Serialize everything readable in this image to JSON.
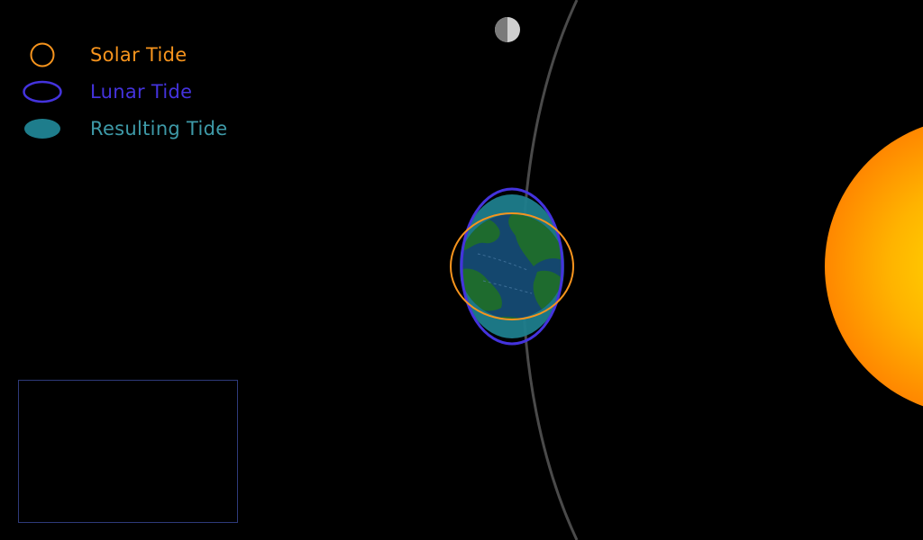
{
  "legend": {
    "items": [
      {
        "key": "solar",
        "label": "Solar Tide",
        "color": "#F7941D"
      },
      {
        "key": "lunar",
        "label": "Lunar Tide",
        "color": "#4433DD"
      },
      {
        "key": "result",
        "label": "Resulting Tide",
        "color": "#1E7D8C"
      }
    ]
  },
  "colors": {
    "background": "#000000",
    "orbit": "#555555",
    "earth_land": "#1E6B2E",
    "earth_ocean": "#14476E",
    "sun_core": "#FFD200",
    "sun_edge": "#FF8A00",
    "info_box_border": "#2E3A7A"
  },
  "icons": {
    "moon": "half-moon-icon",
    "sun": "sun-icon",
    "earth": "earth-icon"
  }
}
